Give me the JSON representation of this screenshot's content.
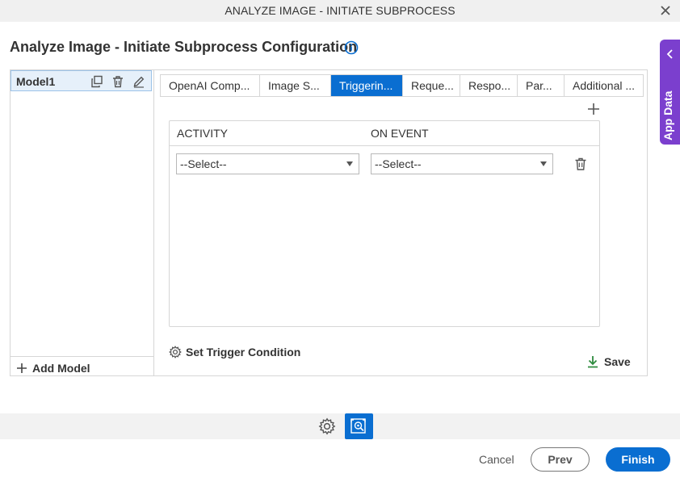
{
  "window": {
    "title": "ANALYZE IMAGE - INITIATE SUBPROCESS",
    "close_icon": "close-icon"
  },
  "page": {
    "heading": "Analyze Image - Initiate Subprocess Configuration",
    "info_icon": "info-icon"
  },
  "app_data": {
    "label": "App Data",
    "icon": "chevron-left-icon",
    "color": "#7b3fce"
  },
  "models": {
    "items": [
      {
        "name": "Model1",
        "icons": [
          "copy-icon",
          "trash-icon",
          "edit-icon"
        ]
      }
    ],
    "add_label": "Add Model"
  },
  "tabs": [
    {
      "label": "OpenAI Comp..."
    },
    {
      "label": "Image S..."
    },
    {
      "label": "Triggerin...",
      "active": true
    },
    {
      "label": "Reque..."
    },
    {
      "label": "Respo..."
    },
    {
      "label": "Par..."
    },
    {
      "label": "Additional ..."
    }
  ],
  "grid": {
    "columns": [
      "ACTIVITY",
      "ON EVENT"
    ],
    "rows": [
      {
        "activity": "--Select--",
        "on_event": "--Select--"
      }
    ]
  },
  "actions": {
    "set_trigger_condition": "Set Trigger Condition",
    "save": "Save"
  },
  "footer": {
    "cancel": "Cancel",
    "prev": "Prev",
    "finish": "Finish"
  },
  "colors": {
    "accent": "#0a6ed1",
    "save_green": "#2e8b3e"
  }
}
